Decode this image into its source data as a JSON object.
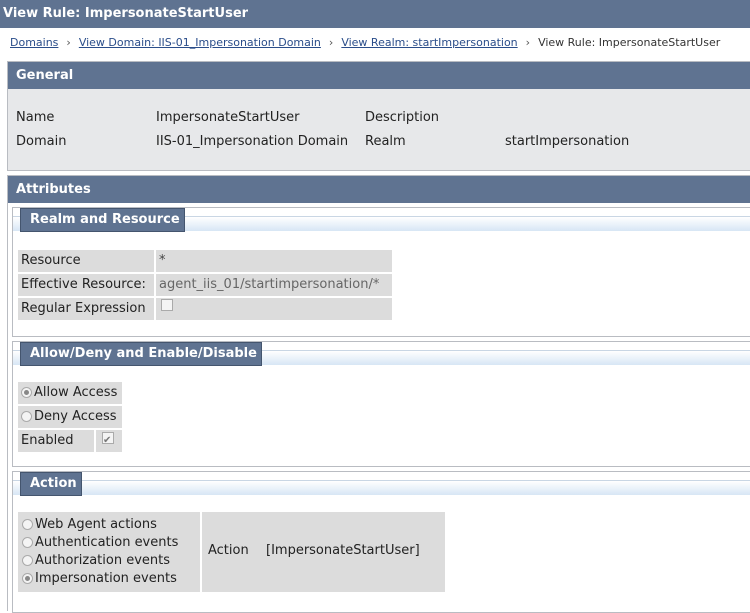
{
  "title": "View Rule: ImpersonateStartUser",
  "breadcrumb": [
    {
      "label": "Domains"
    },
    {
      "label": "View Domain: IIS-01_Impersonation Domain"
    },
    {
      "label": "View Realm: startImpersonation"
    },
    {
      "label": "View Rule: ImpersonateStartUser"
    }
  ],
  "breadcrumb_separator": "›",
  "general": {
    "header": "General",
    "name_label": "Name",
    "name_value": "ImpersonateStartUser",
    "description_label": "Description",
    "description_value": "",
    "domain_label": "Domain",
    "domain_value": "IIS-01_Impersonation Domain",
    "realm_label": "Realm",
    "realm_value": "startImpersonation"
  },
  "attributes": {
    "header": "Attributes",
    "realm_resource": {
      "header": "Realm and Resource",
      "resource_label": "Resource",
      "resource_value": "*",
      "effective_label": "Effective Resource:",
      "effective_value": "agent_iis_01/startimpersonation/*",
      "regex_label": "Regular Expression",
      "regex_checked": false
    },
    "allow_deny": {
      "header": "Allow/Deny and Enable/Disable",
      "allow_label": "Allow Access",
      "allow_selected": true,
      "deny_label": "Deny Access",
      "deny_selected": false,
      "enabled_label": "Enabled",
      "enabled_checked": true
    },
    "action": {
      "header": "Action",
      "options": [
        {
          "label": "Web Agent actions",
          "selected": false
        },
        {
          "label": "Authentication events",
          "selected": false
        },
        {
          "label": "Authorization events",
          "selected": false
        },
        {
          "label": "Impersonation events",
          "selected": true
        }
      ],
      "action_label": "Action",
      "action_value": "[ImpersonateStartUser]"
    }
  },
  "colors": {
    "header_bg": "#5f7391",
    "link": "#2a4d8a",
    "cell_bg": "#dcdcdc"
  }
}
